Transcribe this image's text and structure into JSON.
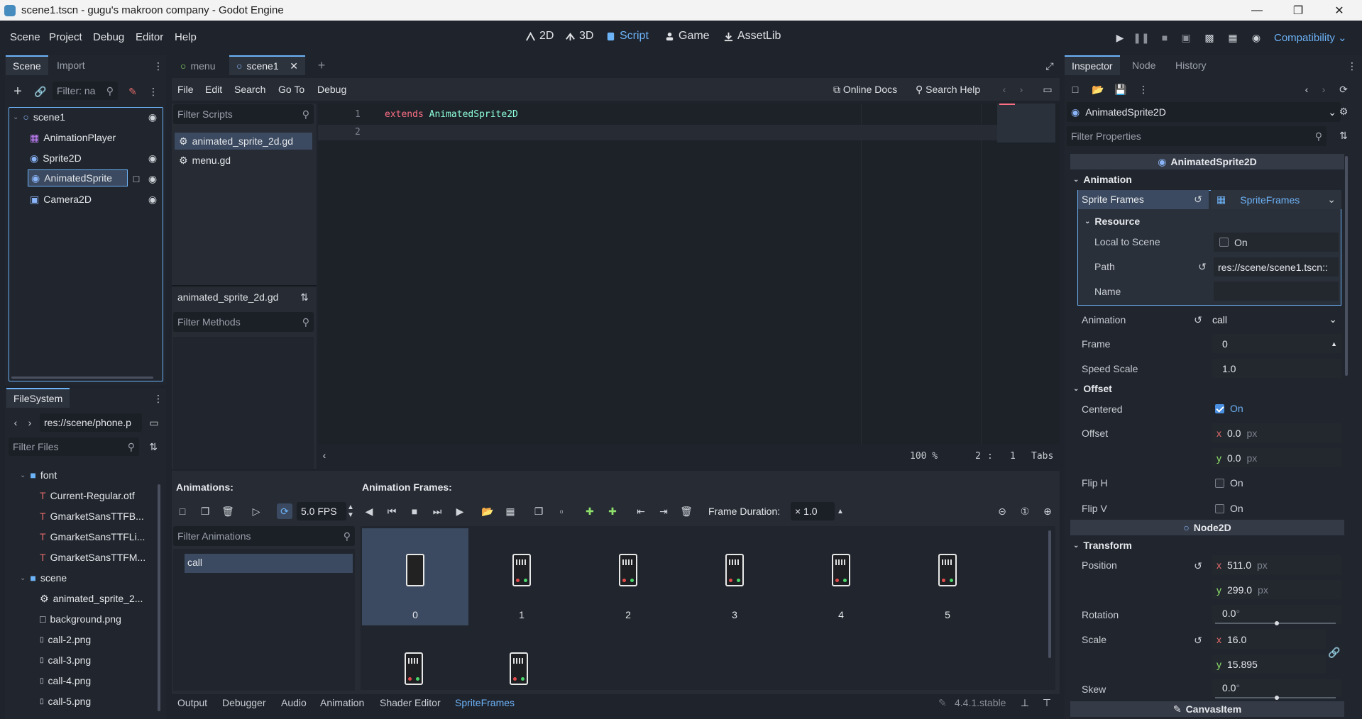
{
  "window": {
    "title": "scene1.tscn - gugu's makroon company - Godot Engine"
  },
  "menu": [
    "Scene",
    "Project",
    "Debug",
    "Editor",
    "Help"
  ],
  "workspaces": [
    {
      "label": "2D",
      "icon": "2d-icon"
    },
    {
      "label": "3D",
      "icon": "3d-icon"
    },
    {
      "label": "Script",
      "icon": "script-icon",
      "active": true
    },
    {
      "label": "Game",
      "icon": "game-icon"
    },
    {
      "label": "AssetLib",
      "icon": "assetlib-icon"
    }
  ],
  "renderer": "Compatibility",
  "scene_dock": {
    "tabs": [
      "Scene",
      "Import"
    ],
    "filter_placeholder": "Filter: na",
    "nodes": [
      {
        "name": "scene1",
        "icon": "node2d-icon"
      },
      {
        "name": "AnimationPlayer",
        "icon": "animation-player-icon"
      },
      {
        "name": "Sprite2D",
        "icon": "sprite2d-icon"
      },
      {
        "name": "AnimatedSprite",
        "icon": "animated-sprite-icon",
        "selected": true
      },
      {
        "name": "Camera2D",
        "icon": "camera2d-icon"
      }
    ]
  },
  "filesystem": {
    "tab": "FileSystem",
    "path": "res://scene/phone.p",
    "filter_placeholder": "Filter Files",
    "items": [
      {
        "name": "font",
        "type": "folder"
      },
      {
        "name": "Current-Regular.otf",
        "type": "font"
      },
      {
        "name": "GmarketSansTTFB...",
        "type": "font"
      },
      {
        "name": "GmarketSansTTFLi...",
        "type": "font"
      },
      {
        "name": "GmarketSansTTFM...",
        "type": "font"
      },
      {
        "name": "scene",
        "type": "folder"
      },
      {
        "name": "animated_sprite_2...",
        "type": "script"
      },
      {
        "name": "background.png",
        "type": "image"
      },
      {
        "name": "call-2.png",
        "type": "image"
      },
      {
        "name": "call-3.png",
        "type": "image"
      },
      {
        "name": "call-4.png",
        "type": "image"
      },
      {
        "name": "call-5.png",
        "type": "image"
      }
    ]
  },
  "editor_tabs": [
    {
      "label": "menu"
    },
    {
      "label": "scene1",
      "active": true
    }
  ],
  "script_menu": [
    "File",
    "Edit",
    "Search",
    "Go To",
    "Debug"
  ],
  "online_docs": "Online Docs",
  "search_help": "Search Help",
  "scripts_panel": {
    "filter_placeholder": "Filter Scripts",
    "scripts": [
      "animated_sprite_2d.gd",
      "menu.gd"
    ],
    "current": "animated_sprite_2d.gd",
    "methods_placeholder": "Filter Methods"
  },
  "code": {
    "lines": [
      {
        "num": "1",
        "keyword": "extends",
        "type": "AnimatedSprite2D"
      },
      {
        "num": "2",
        "keyword": "",
        "type": ""
      }
    ],
    "zoom": "100 %",
    "line": "2",
    "col": "1",
    "indent": "Tabs"
  },
  "animations_panel": {
    "title": "Animations:",
    "fps": "5.0 FPS",
    "filter_placeholder": "Filter Animations",
    "items": [
      "call"
    ]
  },
  "frames_panel": {
    "title": "Animation Frames:",
    "frame_duration_label": "Frame Duration:",
    "frame_duration": "× 1.0",
    "frames": [
      "0",
      "1",
      "2",
      "3",
      "4",
      "5",
      "",
      ""
    ]
  },
  "bottom_tabs": [
    "Output",
    "Debugger",
    "Audio",
    "Animation",
    "Shader Editor",
    "SpriteFrames"
  ],
  "version": "4.4.1.stable",
  "inspector": {
    "tabs": [
      "Inspector",
      "Node",
      "History"
    ],
    "object": "AnimatedSprite2D",
    "filter_placeholder": "Filter Properties",
    "class_header": "AnimatedSprite2D",
    "animation_section": "Animation",
    "sprite_frames_label": "Sprite Frames",
    "sprite_frames_value": "SpriteFrames",
    "resource_section": "Resource",
    "local_to_scene_label": "Local to Scene",
    "local_to_scene_value": "On",
    "path_label": "Path",
    "path_value": "res://scene/scene1.tscn::",
    "name_label": "Name",
    "animation_label": "Animation",
    "animation_value": "call",
    "frame_label": "Frame",
    "frame_value": "0",
    "speed_label": "Speed Scale",
    "speed_value": "1.0",
    "offset_section": "Offset",
    "centered_label": "Centered",
    "centered_value": "On",
    "offset_label": "Offset",
    "offset_x": "0.0",
    "offset_y": "0.0",
    "unit_px": "px",
    "fliph_label": "Flip H",
    "fliph_value": "On",
    "flipv_label": "Flip V",
    "flipv_value": "On",
    "node2d_header": "Node2D",
    "transform_section": "Transform",
    "position_label": "Position",
    "position_x": "511.0",
    "position_y": "299.0",
    "rotation_label": "Rotation",
    "rotation_value": "0.0",
    "scale_label": "Scale",
    "scale_x": "16.0",
    "scale_y": "15.895",
    "skew_label": "Skew",
    "skew_value": "0.0",
    "canvasitem_header": "CanvasItem",
    "degree": "°",
    "x": "x",
    "y": "y"
  }
}
